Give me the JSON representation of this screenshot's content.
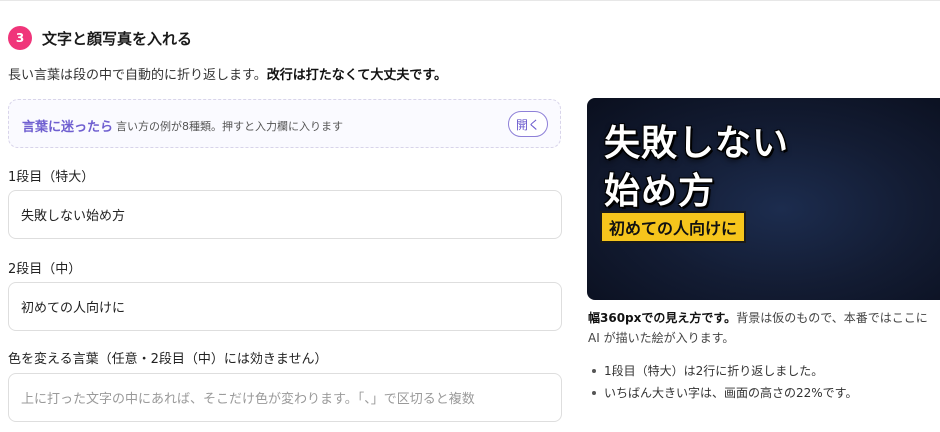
{
  "step": {
    "number": "3",
    "title": "文字と顔写真を入れる"
  },
  "intro": {
    "text": "長い言葉は段の中で自動的に折り返します。",
    "emphasis": "改行は打たなくて大丈夫です。"
  },
  "hint": {
    "label": "言葉に迷ったら",
    "text": "言い方の例が8種類。押すと入力欄に入ります",
    "open_button": "開く"
  },
  "fields": {
    "line1": {
      "label": "1段目（特大）",
      "value": "失敗しない始め方"
    },
    "line2": {
      "label": "2段目（中）",
      "value": "初めての人向けに"
    },
    "color_words": {
      "label": "色を変える言葉（任意・2段目（中）には効きません）",
      "placeholder": "上に打った文字の中にあれば、そこだけ色が変わります。「、」で区切ると複数"
    }
  },
  "preview": {
    "line1": "失敗しない",
    "line2": "始め方",
    "sub": "初めての人向けに",
    "colors": {
      "background": "#131c33",
      "highlight": "#f6c51c"
    }
  },
  "caption": {
    "emphasis": "幅360pxでの見え方です。",
    "text": "背景は仮のもので、本番ではここに AI が描いた絵が入ります。"
  },
  "notes": [
    "1段目（特大）は2行に折り返しました。",
    "いちばん大きい字は、画面の高さの22%です。"
  ],
  "colors": {
    "accent": "#f0357a",
    "purple": "#6f5fd0"
  }
}
